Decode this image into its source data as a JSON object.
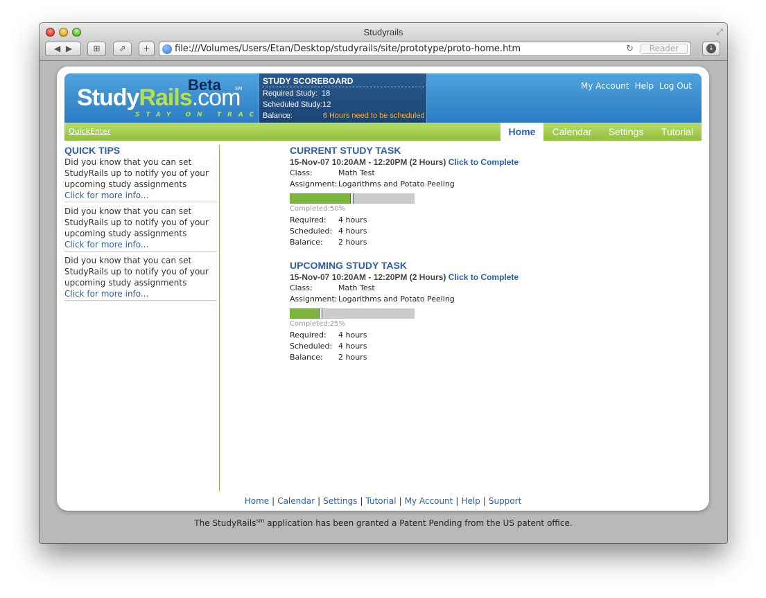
{
  "window": {
    "title": "Studyrails"
  },
  "toolbar": {
    "url": "file:///Volumes/Users/Etan/Desktop/studyrails/site/prototype/proto-home.htm",
    "reader_label": "Reader"
  },
  "header": {
    "logo": {
      "study": "Study",
      "rails": "Rails",
      "dotcom": ".com",
      "beta": "Beta",
      "sm": "SM",
      "tagline": "STAY ON TRACK"
    },
    "scoreboard": {
      "title": "STUDY SCOREBOARD",
      "rows": [
        {
          "label": "Required Study:",
          "value": "18"
        },
        {
          "label": "Scheduled Study:",
          "value": "12"
        },
        {
          "label": "Balance:",
          "value": "6 Hours need to be scheduled"
        }
      ]
    },
    "links": [
      "My Account",
      "Help",
      "Log Out"
    ]
  },
  "nav": {
    "quickenter": "QuickEnter",
    "tabs": [
      "Home",
      "Calendar",
      "Settings",
      "Tutorial"
    ],
    "active_tab": "Home"
  },
  "sidebar": {
    "title": "QUICK TIPS",
    "tips": [
      {
        "text": "Did you know that you can set StudyRails up to notify you of your upcoming study assignments",
        "link": "Click for more info..."
      },
      {
        "text": "Did you know that you can set StudyRails up to notify you of your upcoming study assignments",
        "link": "Click for more info..."
      },
      {
        "text": "Did you know that you can set StudyRails up to notify you of your upcoming study assignments",
        "link": "Click for more info..."
      }
    ]
  },
  "tasks": [
    {
      "title": "CURRENT STUDY TASK",
      "time": "15-Nov-07 10:20AM - 12:20PM (2 Hours)",
      "complete_link": "Click to Complete",
      "class_label": "Class:",
      "class_value": "Math Test",
      "assignment_label": "Assignment:",
      "assignment_value": "Logarithms and Potato Peeling",
      "completed_text": "Completed:50%",
      "progress": 0.5,
      "required_label": "Required:",
      "required_value": "4 hours",
      "scheduled_label": "Scheduled:",
      "scheduled_value": "4 hours",
      "balance_label": "Balance:",
      "balance_value": "2 hours"
    },
    {
      "title": "UPCOMING STUDY TASK",
      "time": "15-Nov-07 10:20AM - 12:20PM (2 Hours)",
      "complete_link": "Click to Complete",
      "class_label": "Class:",
      "class_value": "Math Test",
      "assignment_label": "Assignment:",
      "assignment_value": "Logarithms and Potato Peeling",
      "completed_text": "Completed:25%",
      "progress": 0.25,
      "required_label": "Required:",
      "required_value": "4 hours",
      "scheduled_label": "Scheduled:",
      "scheduled_value": "4 hours",
      "balance_label": "Balance:",
      "balance_value": "2 hours"
    }
  ],
  "footer": {
    "links": [
      "Home",
      "Calendar",
      "Settings",
      "Tutorial",
      "My Account",
      "Help",
      "Support"
    ],
    "patent_before": "The StudyRails",
    "patent_sup": "sm",
    "patent_after": " application has been granted a Patent Pending from the US patent office."
  },
  "colors": {
    "brand_blue": "#2c5fa6",
    "nav_green": "#8fc23a",
    "progress_green": "#7bb53b",
    "alert_orange": "#f4b33a"
  }
}
